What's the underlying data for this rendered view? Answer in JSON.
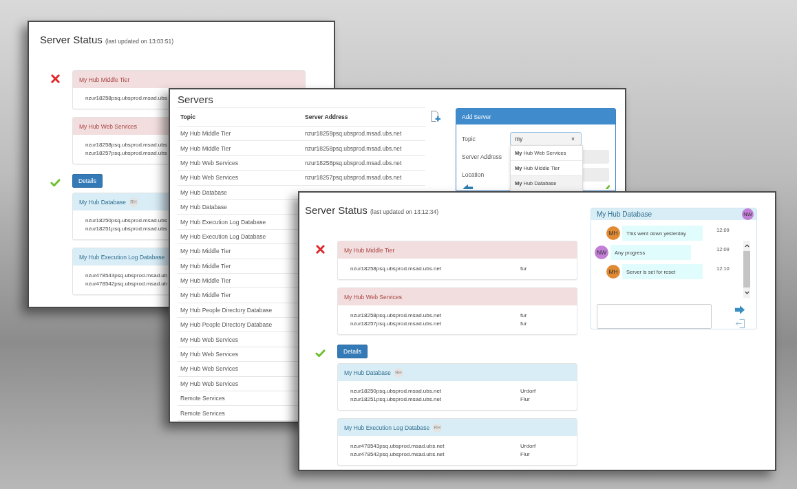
{
  "status_windows": [
    {
      "title": "Server Status",
      "updated": "(last updated on 13:03:51)",
      "sections": [
        {
          "ok": false,
          "services": [
            {
              "name": "My Hub Middle Tier",
              "hosts": [
                {
                  "address": "nzur18258psq.ubsprod.msad.ubs"
                }
              ]
            },
            {
              "name": "My Hub Web Services",
              "hosts": [
                {
                  "address": "nzur18258psq.ubsprod.msad.ubs"
                },
                {
                  "address": "nzur18257psq.ubsprod.msad.ubs"
                }
              ]
            }
          ]
        },
        {
          "ok": true,
          "button": "Details",
          "services": [
            {
              "name": "My Hub Database",
              "badge": "RH",
              "hosts": [
                {
                  "address": "nzur18250psq.ubsprod.msad.ubs"
                },
                {
                  "address": "nzur18251psq.ubsprod.msad.ubs"
                }
              ]
            },
            {
              "name": "My Hub Execution Log Database",
              "hosts": [
                {
                  "address": "nzur478543psq.ubsprod.msad.ub"
                },
                {
                  "address": "nzur478542psq.ubsprod.msad.ub"
                }
              ]
            }
          ]
        }
      ]
    },
    {
      "title": "Server Status",
      "updated": "(last updated on 13:12:34)",
      "sections": [
        {
          "ok": false,
          "services": [
            {
              "name": "My Hub Middle Tier",
              "hosts": [
                {
                  "address": "nzur18258psq.ubsprod.msad.ubs.net",
                  "location": "fur"
                }
              ]
            },
            {
              "name": "My Hub Web Services",
              "hosts": [
                {
                  "address": "nzur18258psq.ubsprod.msad.ubs.net",
                  "location": "fur"
                },
                {
                  "address": "nzur18257psq.ubsprod.msad.ubs.net",
                  "location": "fur"
                }
              ]
            }
          ]
        },
        {
          "ok": true,
          "button": "Details",
          "services": [
            {
              "name": "My Hub Database",
              "badge": "RH",
              "hosts": [
                {
                  "address": "nzur18250psq.ubsprod.msad.ubs.net",
                  "location": "Urdorf"
                },
                {
                  "address": "nzur18251psq.ubsprod.msad.ubs.net",
                  "location": "Flur"
                }
              ]
            },
            {
              "name": "My Hub Execution Log Database",
              "badge": "RH",
              "hosts": [
                {
                  "address": "nzur478543psq.ubsprod.msad.ubs.net",
                  "location": "Urdorf"
                },
                {
                  "address": "nzur478542psq.ubsprod.msad.ubs.net",
                  "location": "Flur"
                }
              ]
            }
          ]
        }
      ],
      "chat": {
        "title": "My Hub Database",
        "participant": {
          "initials": "NW",
          "color": "#c27fd6"
        },
        "messages": [
          {
            "kind": "mine",
            "initials": "MH",
            "color": "#e08a34",
            "text": "This went down yesterday",
            "time": "12:09"
          },
          {
            "kind": "theirs",
            "initials": "NW",
            "color": "#c27fd6",
            "text": "Any progress",
            "time": "12:09"
          },
          {
            "kind": "mine",
            "initials": "MH",
            "color": "#e08a34",
            "text": "Server is set for reset",
            "time": "12:10"
          }
        ]
      }
    }
  ],
  "servers_window": {
    "title": "Servers",
    "table": {
      "columns": [
        "Topic",
        "Server Address"
      ],
      "rows": [
        {
          "topic": "My Hub Middle Tier",
          "address": "nzur18259psq.ubsprod.msad.ubs.net"
        },
        {
          "topic": "My Hub Middle Tier",
          "address": "nzur18258psq.ubsprod.msad.ubs.net"
        },
        {
          "topic": "My Hub Web Services",
          "address": "nzur18258psq.ubsprod.msad.ubs.net"
        },
        {
          "topic": "My Hub Web Services",
          "address": "nzur18257psq.ubsprod.msad.ubs.net"
        },
        {
          "topic": "My Hub Database"
        },
        {
          "topic": "My Hub Database"
        },
        {
          "topic": "My Hub Execution Log Database"
        },
        {
          "topic": "My Hub Execution Log Database"
        },
        {
          "topic": "My Hub Middle Tier"
        },
        {
          "topic": "My Hub Middle Tier"
        },
        {
          "topic": "My Hub Middle Tier"
        },
        {
          "topic": "My Hub Middle Tier"
        },
        {
          "topic": "My Hub People Directory Database"
        },
        {
          "topic": "My Hub People Directory Database"
        },
        {
          "topic": "My Hub Web Services"
        },
        {
          "topic": "My Hub Web Services"
        },
        {
          "topic": "My Hub Web Services"
        },
        {
          "topic": "My Hub Web Services"
        },
        {
          "topic": "Remote Services"
        },
        {
          "topic": "Remote Services"
        }
      ]
    },
    "add_server": {
      "title": "Add Server",
      "fields": [
        {
          "label": "Topic",
          "value": "my",
          "clear": "×"
        },
        {
          "label": "Server Address"
        },
        {
          "label": "Location"
        }
      ],
      "suggestions": [
        "**My** Hub Web Services",
        "**My** Hub Middle Tier",
        "**My** Hub Database"
      ]
    }
  }
}
